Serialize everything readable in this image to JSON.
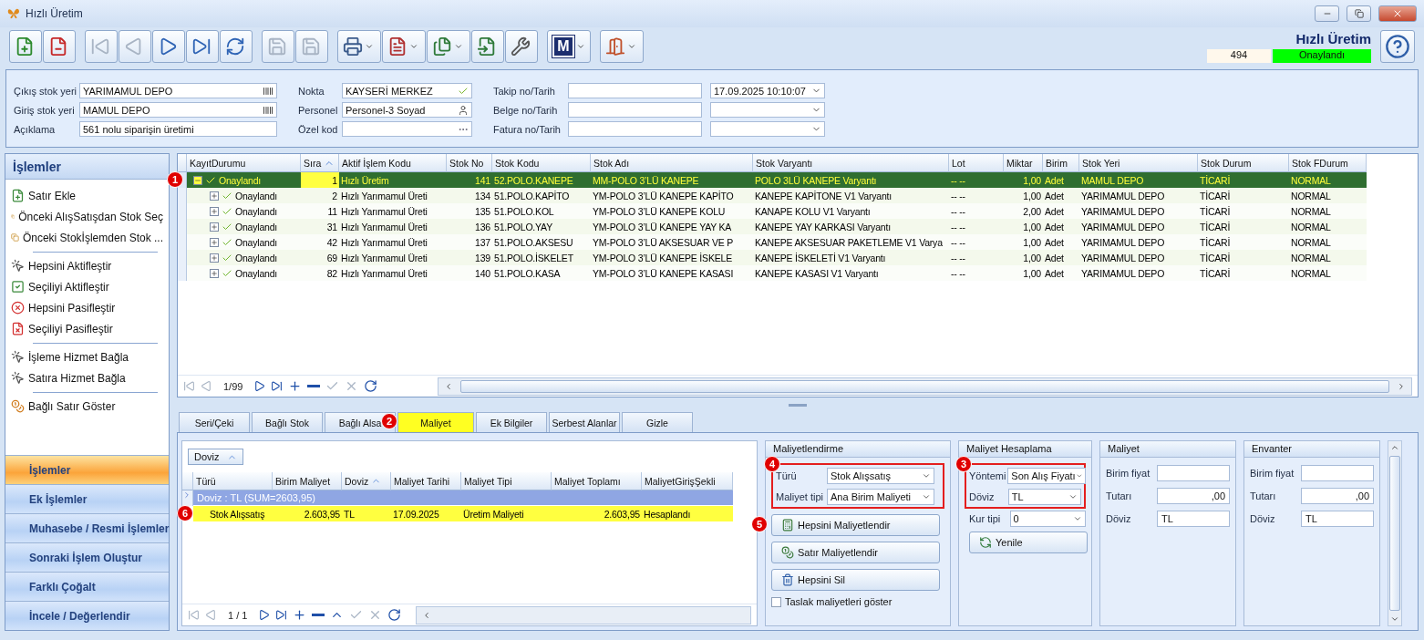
{
  "window": {
    "title": "Hızlı Üretim"
  },
  "toolbar": {
    "groups": [
      [
        {
          "disabled": false,
          "dropdown": false
        },
        {
          "disabled": false,
          "dropdown": false
        }
      ],
      [
        {
          "disabled": true,
          "dropdown": false
        },
        {
          "disabled": true,
          "dropdown": false
        },
        {
          "disabled": false,
          "dropdown": false
        },
        {
          "disabled": false,
          "dropdown": false
        },
        {
          "disabled": false,
          "dropdown": false
        }
      ],
      [
        {
          "disabled": true,
          "dropdown": false
        },
        {
          "disabled": true,
          "dropdown": false
        }
      ],
      [
        {
          "disabled": false,
          "dropdown": true
        },
        {
          "disabled": false,
          "dropdown": true
        },
        {
          "disabled": false,
          "dropdown": true
        },
        {
          "disabled": false,
          "dropdown": false
        },
        {
          "disabled": false,
          "dropdown": false
        }
      ],
      [
        {
          "disabled": false,
          "dropdown": true,
          "label": "M"
        }
      ],
      [
        {
          "disabled": false,
          "dropdown": true
        }
      ]
    ]
  },
  "header": {
    "title": "Hızlı Üretim",
    "number": "494",
    "status": "Onaylandı"
  },
  "form": {
    "columns": [
      [
        {
          "label": "Çıkış stok yeri",
          "fields": [
            {
              "kind": "picker",
              "value": "YARIMAMUL DEPO"
            }
          ]
        },
        {
          "label": "Giriş stok yeri",
          "fields": [
            {
              "kind": "picker",
              "value": "MAMUL DEPO"
            }
          ]
        },
        {
          "label": "Açıklama",
          "fields": [
            {
              "kind": "text",
              "value": "561 nolu siparişin üretimi"
            }
          ]
        }
      ],
      [
        {
          "label": "Nokta",
          "fields": [
            {
              "kind": "check",
              "value": "KAYSERİ MERKEZ"
            }
          ]
        },
        {
          "label": "Personel",
          "fields": [
            {
              "kind": "person",
              "value": "Personel-3 Soyad"
            }
          ]
        },
        {
          "label": "Özel kod",
          "fields": [
            {
              "kind": "ellipsis"
            }
          ]
        }
      ],
      [
        {
          "label": "Takip no/Tarih",
          "fields": [
            {
              "kind": "text"
            },
            {
              "kind": "combo",
              "value": "17.09.2025 10:10:07"
            }
          ]
        },
        {
          "label": "Belge no/Tarih",
          "fields": [
            {
              "kind": "text"
            },
            {
              "kind": "combo"
            }
          ]
        },
        {
          "label": "Fatura no/Tarih",
          "fields": [
            {
              "kind": "text"
            },
            {
              "kind": "combo"
            }
          ]
        }
      ]
    ]
  },
  "sidebar": {
    "title": "İşlemler",
    "items": [
      {
        "label": "Satır Ekle",
        "separator_before": false
      },
      {
        "label": "Önceki AlışSatışdan Stok Seç",
        "separator_before": false
      },
      {
        "label": "Önceki Stokİşlemden Stok ...",
        "separator_before": false
      },
      {
        "label": "Hepsini Aktifleştir",
        "separator_before": true
      },
      {
        "label": "Seçiliyi Aktifleştir",
        "separator_before": false
      },
      {
        "label": "Hepsini Pasifleştir",
        "separator_before": false
      },
      {
        "label": "Seçiliyi Pasifleştir",
        "separator_before": false
      },
      {
        "label": "İşleme Hizmet Bağla",
        "separator_before": true
      },
      {
        "label": "Satıra Hizmet Bağla",
        "separator_before": false
      },
      {
        "label": "Bağlı Satır Göster",
        "separator_before": true
      }
    ],
    "groups": [
      {
        "label": "İşlemler",
        "selected": true
      },
      {
        "label": "Ek İşlemler",
        "selected": false
      },
      {
        "label": "Muhasebe / Resmi İşlemler",
        "selected": false
      },
      {
        "label": "Sonraki İşlem Oluştur",
        "selected": false
      },
      {
        "label": "Farklı Çoğalt",
        "selected": false
      },
      {
        "label": "İncele / Değerlendir",
        "selected": false
      }
    ]
  },
  "grid": {
    "callout": "1",
    "columns": [
      {
        "label": "KayıtDurumu",
        "sorted": false
      },
      {
        "label": "Sıra",
        "sorted": true
      },
      {
        "label": "Aktif İşlem Kodu",
        "sorted": false
      },
      {
        "label": "Stok No",
        "sorted": false
      },
      {
        "label": "Stok Kodu",
        "sorted": false
      },
      {
        "label": "Stok Adı",
        "sorted": false
      },
      {
        "label": "Stok Varyantı",
        "sorted": false
      },
      {
        "label": "Lot",
        "sorted": false
      },
      {
        "label": "Miktar",
        "sorted": false
      },
      {
        "label": "Birim",
        "sorted": false
      },
      {
        "label": "Stok Yeri",
        "sorted": false
      },
      {
        "label": "Stok Durum",
        "sorted": false
      },
      {
        "label": "Stok FDurum",
        "sorted": false
      }
    ],
    "rows": [
      {
        "selected": true,
        "expanded": true,
        "cells": [
          "Onaylandı",
          "1",
          "Hızlı Üretim",
          "141",
          "52.POLO.KANEPE",
          "MM-POLO 3’LÜ KANEPE",
          "POLO 3LÜ KANEPE Varyantı",
          "-- --",
          "1,00",
          "Adet",
          "MAMUL DEPO",
          "TİCARİ",
          "NORMAL"
        ]
      },
      {
        "selected": false,
        "expanded": false,
        "cells": [
          "Onaylandı",
          "2",
          "Hızlı Yarımamul Üreti",
          "134",
          "51.POLO.KAPİTO",
          "YM-POLO 3’LÜ KANEPE KAPİTO",
          "KANEPE KAPİTONE V1 Varyantı",
          "-- --",
          "1,00",
          "Adet",
          "YARIMAMUL DEPO",
          "TİCARİ",
          "NORMAL"
        ]
      },
      {
        "selected": false,
        "expanded": false,
        "cells": [
          "Onaylandı",
          "11",
          "Hızlı Yarımamul Üreti",
          "135",
          "51.POLO.KOL",
          "YM-POLO 3’LÜ KANEPE KOLU",
          "KANAPE KOLU V1 Varyantı",
          "-- --",
          "2,00",
          "Adet",
          "YARIMAMUL DEPO",
          "TİCARİ",
          "NORMAL"
        ]
      },
      {
        "selected": false,
        "expanded": false,
        "cells": [
          "Onaylandı",
          "31",
          "Hızlı Yarımamul Üreti",
          "136",
          "51.POLO.YAY",
          "YM-POLO 3’LÜ KANEPE YAY KA",
          "KANEPE YAY KARKASI Varyantı",
          "-- --",
          "1,00",
          "Adet",
          "YARIMAMUL DEPO",
          "TİCARİ",
          "NORMAL"
        ]
      },
      {
        "selected": false,
        "expanded": false,
        "cells": [
          "Onaylandı",
          "42",
          "Hızlı Yarımamul Üreti",
          "137",
          "51.POLO.AKSESU",
          "YM-POLO 3’LÜ AKSESUAR VE P",
          "KANEPE AKSESUAR PAKETLEME V1 Varya",
          "-- --",
          "1,00",
          "Adet",
          "YARIMAMUL DEPO",
          "TİCARİ",
          "NORMAL"
        ]
      },
      {
        "selected": false,
        "expanded": false,
        "cells": [
          "Onaylandı",
          "69",
          "Hızlı Yarımamul Üreti",
          "139",
          "51.POLO.İSKELET",
          "YM-POLO 3’LÜ KANEPE İSKELE",
          "KANEPE İSKELETİ V1 Varyantı",
          "-- --",
          "1,00",
          "Adet",
          "YARIMAMUL DEPO",
          "TİCARİ",
          "NORMAL"
        ]
      },
      {
        "selected": false,
        "expanded": false,
        "cells": [
          "Onaylandı",
          "82",
          "Hızlı Yarımamul Üreti",
          "140",
          "51.POLO.KASA",
          "YM-POLO 3’LÜ KANEPE KASASI",
          "KANEPE KASASI V1 Varyantı",
          "-- --",
          "1,00",
          "Adet",
          "YARIMAMUL DEPO",
          "TİCARİ",
          "NORMAL"
        ]
      }
    ],
    "pager": "1/99"
  },
  "tabs": [
    {
      "label": "Seri/Çeki",
      "selected": false
    },
    {
      "label": "Bağlı Stok",
      "selected": false
    },
    {
      "label": "Bağlı Alsa",
      "selected": false
    },
    {
      "label": "Maliyet",
      "selected": true,
      "callout": "2"
    },
    {
      "label": "Ek Bilgiler",
      "selected": false
    },
    {
      "label": "Serbest Alanlar",
      "selected": false
    },
    {
      "label": "Gizle",
      "selected": false
    }
  ],
  "cost_grid": {
    "group_chip": "Doviz",
    "callout": "6",
    "columns": [
      {
        "label": "Türü",
        "sorted": false
      },
      {
        "label": "Birim Maliyet",
        "sorted": false
      },
      {
        "label": "Doviz",
        "sorted": true
      },
      {
        "label": "Maliyet Tarihi",
        "sorted": false
      },
      {
        "label": "Maliyet Tipi",
        "sorted": false
      },
      {
        "label": "Maliyet Toplamı",
        "sorted": false
      },
      {
        "label": "MaliyetGirişŞekli",
        "sorted": false
      }
    ],
    "group_row": "Doviz : TL (SUM=2603,95)",
    "rows": [
      {
        "selected": true,
        "cells": [
          "Stok Alışsatış",
          "2.603,95",
          "TL",
          "17.09.2025",
          "Üretim Maliyeti",
          "2.603,95",
          "Hesaplandı"
        ]
      }
    ],
    "pager": "1 / 1"
  },
  "costing": {
    "title": "Maliyetlendirme",
    "callout": "4",
    "highlighted": true,
    "fields": [
      {
        "label": "Türü",
        "value": "Stok Alışsatış"
      },
      {
        "label": "Maliyet tipi",
        "value": "Ana Birim Maliyeti"
      }
    ],
    "buttons": [
      {
        "label": "Hepsini Maliyetlendir",
        "callout": "5"
      },
      {
        "label": "Satır Maliyetlendir"
      },
      {
        "label": "Hepsini Sil"
      }
    ],
    "draft_checkbox": {
      "label": "Taslak maliyetleri göster",
      "checked": false
    }
  },
  "calculation": {
    "title": "Maliyet Hesaplama",
    "callout": "3",
    "highlighted": true,
    "fields": [
      {
        "label": "Yöntemi",
        "value": "Son Alış Fiyatı"
      },
      {
        "label": "Döviz",
        "value": "TL"
      }
    ],
    "rate": {
      "label": "Kur tipi",
      "value": "0"
    },
    "button": "Yenile"
  },
  "value_panels": [
    {
      "title": "Maliyet",
      "fields": [
        {
          "label": "Birim fiyat",
          "kind": "text"
        },
        {
          "label": "Tutarı",
          "value": ",00",
          "kind": "amount"
        },
        {
          "label": "Döviz",
          "value": "TL",
          "kind": "text"
        }
      ]
    },
    {
      "title": "Envanter",
      "fields": [
        {
          "label": "Birim fiyat",
          "kind": "text"
        },
        {
          "label": "Tutarı",
          "value": ",00",
          "kind": "amount"
        },
        {
          "label": "Döviz",
          "value": "TL",
          "kind": "text"
        }
      ]
    }
  ]
}
